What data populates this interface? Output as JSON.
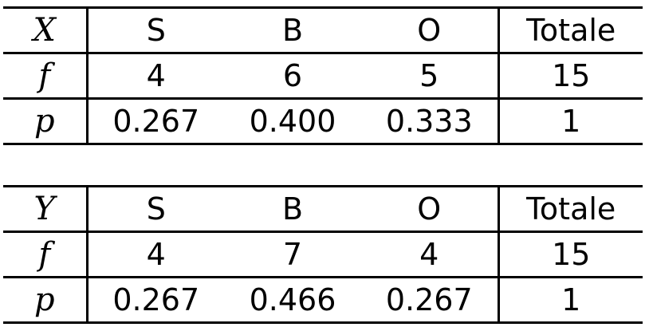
{
  "tables": [
    {
      "variable": "X",
      "header": [
        "S",
        "B",
        "O",
        "Totale"
      ],
      "rows": [
        {
          "label": "f",
          "values": [
            "4",
            "6",
            "5",
            "15"
          ]
        },
        {
          "label": "p",
          "values": [
            "0.267",
            "0.400",
            "0.333",
            "1"
          ]
        }
      ]
    },
    {
      "variable": "Y",
      "header": [
        "S",
        "B",
        "O",
        "Totale"
      ],
      "rows": [
        {
          "label": "f",
          "values": [
            "4",
            "7",
            "4",
            "15"
          ]
        },
        {
          "label": "p",
          "values": [
            "0.267",
            "0.466",
            "0.267",
            "1"
          ]
        }
      ]
    }
  ]
}
